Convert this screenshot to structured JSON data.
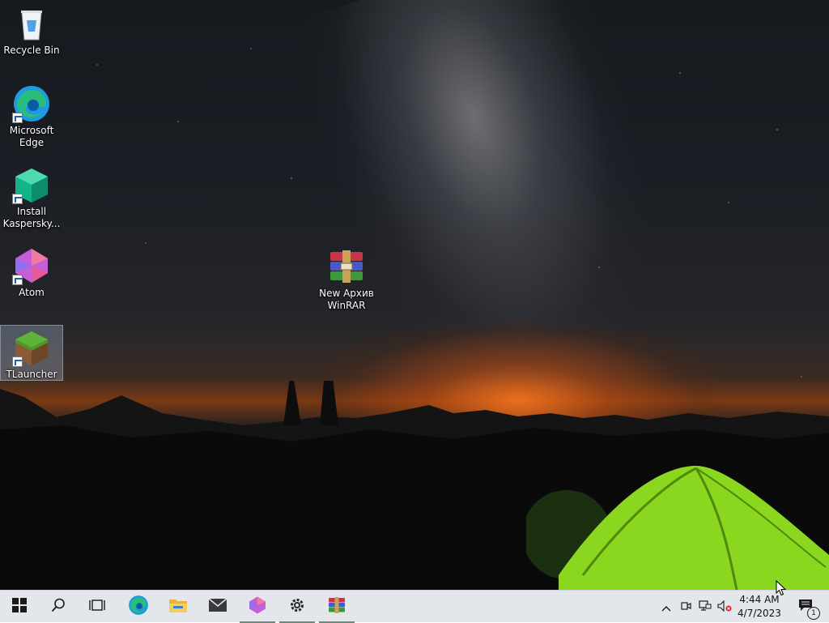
{
  "desktop": {
    "icons": [
      {
        "label": "Recycle Bin",
        "icon": "recycle-bin-icon"
      },
      {
        "label": "Microsoft Edge",
        "icon": "edge-icon"
      },
      {
        "label": "Install Kaspersky...",
        "icon": "kaspersky-installer-icon"
      },
      {
        "label": "Atom",
        "icon": "atom-icon"
      },
      {
        "label": "TLauncher",
        "icon": "tlauncher-icon",
        "selected": true
      },
      {
        "label": "New Архив WinRAR",
        "icon": "winrar-archive-icon"
      }
    ]
  },
  "taskbar": {
    "start": "start-icon",
    "search": "search-icon",
    "task_view": "task-view-icon",
    "pinned": [
      {
        "name": "Microsoft Edge",
        "icon": "edge-icon",
        "running": false
      },
      {
        "name": "File Explorer",
        "icon": "folder-icon",
        "running": false
      },
      {
        "name": "Mail",
        "icon": "mail-icon",
        "running": false
      },
      {
        "name": "Atom",
        "icon": "atom-icon",
        "running": true
      },
      {
        "name": "Settings",
        "icon": "gear-icon",
        "running": true
      },
      {
        "name": "WinRAR",
        "icon": "winrar-icon",
        "running": true
      }
    ],
    "tray": {
      "icons": [
        "chevron-up-icon",
        "meet-now-icon",
        "network-icon",
        "volume-muted-icon"
      ],
      "time": "4:44 AM",
      "date": "4/7/2023",
      "notifications_count": "1"
    }
  }
}
